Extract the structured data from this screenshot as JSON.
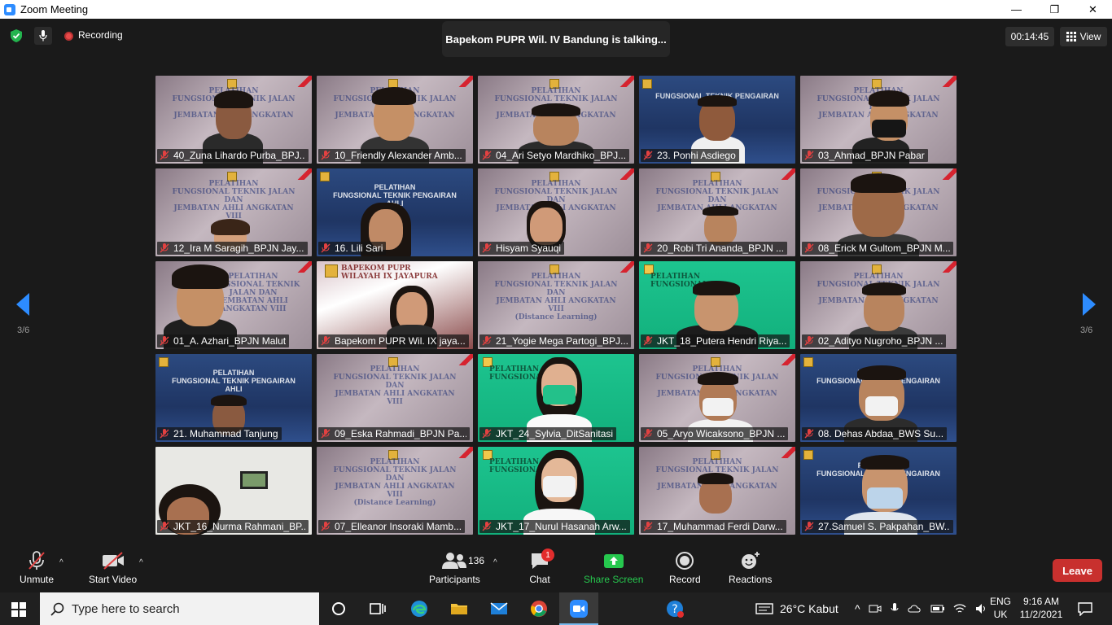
{
  "window": {
    "title": "Zoom Meeting",
    "minimize": "—",
    "maximize": "❐",
    "close": "✕"
  },
  "topbar": {
    "recording_label": "Recording",
    "talking_banner": "Bapekom PUPR Wil. IV Bandung is talking...",
    "timer": "00:14:45",
    "view_label": "View"
  },
  "gallery": {
    "page_left": "3/6",
    "page_right": "3/6",
    "participants": [
      "40_Zuna Lihardo Purba_BPJ...",
      "10_Friendly Alexander Amb...",
      "04_Ari Setyo Mardhiko_BPJ...",
      "23. Ponhi Asdiego",
      "03_Ahmad_BPJN Pabar",
      "12_Ira M Saragih_BPJN Jay...",
      "16. Lili Sari",
      "Hisyam Syauqi",
      "20_Robi Tri Ananda_BPJN ...",
      "08_Erick M Gultom_BPJN M...",
      "01_A. Azhari_BPJN Malut",
      "Bapekom PUPR Wil. IX jaya...",
      "21_Yogie Mega Partogi_BPJ...",
      "JKT_18_Putera Hendri Riya...",
      "02_Adityo Nugroho_BPJN ...",
      "21. Muhammad Tanjung",
      "09_Eska Rahmadi_BPJN Pa...",
      "JKT_24_Sylvia_DitSanitasi",
      "05_Aryo Wicaksono_BPJN ...",
      "08. Dehas Abdaa_BWS Su...",
      "JKT_16_Nurma Rahmani_BP...",
      "07_Elleanor Insoraki Mamb...",
      "JKT_17_Nurul Hasanah Arw...",
      "17_Muhammad Ferdi Darw...",
      "27.Samuel S. Pakpahan_BW..."
    ]
  },
  "toolbar": {
    "unmute": "Unmute",
    "start_video": "Start Video",
    "participants": "Participants",
    "participants_count": "136",
    "chat": "Chat",
    "chat_badge": "1",
    "share_screen": "Share Screen",
    "record": "Record",
    "reactions": "Reactions",
    "leave": "Leave"
  },
  "taskbar": {
    "search_placeholder": "Type here to search",
    "weather": "26°C  Kabut",
    "lang_top": "ENG",
    "lang_bottom": "UK",
    "time": "9:16 AM",
    "date": "11/2/2021"
  },
  "colors": {
    "share_green": "#26c84e",
    "leave_red": "#c8302e",
    "zoom_blue": "#2D8CFF"
  }
}
